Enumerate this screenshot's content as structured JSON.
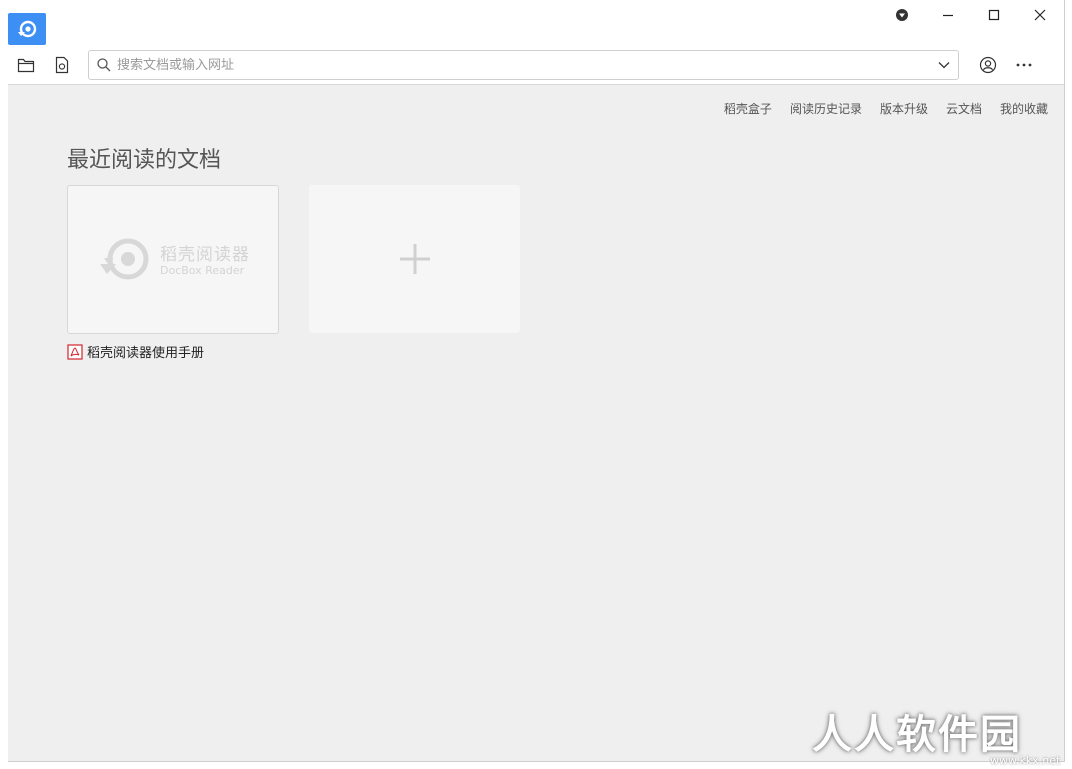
{
  "app": {
    "name": "稻壳阅读器",
    "name_en": "DocBox Reader",
    "accent": "#3d8ff4"
  },
  "titlebar": {
    "icons": [
      "app-logo-icon",
      "user-dropdown-icon",
      "minimize-icon",
      "maximize-icon",
      "close-icon"
    ]
  },
  "toolbar": {
    "search_placeholder": "搜索文档或输入网址",
    "search_value": "",
    "icons": [
      "folder-open-icon",
      "file-icon",
      "search-icon",
      "chevron-down-icon",
      "account-icon",
      "more-icon"
    ]
  },
  "nav": {
    "links": [
      "稻壳盒子",
      "阅读历史记录",
      "版本升级",
      "云文档",
      "我的收藏"
    ]
  },
  "main": {
    "section_title": "最近阅读的文档",
    "recent_docs": [
      {
        "name": "稻壳阅读器使用手册",
        "type": "pdf",
        "thumb_cn": "稻壳阅读器",
        "thumb_en": "DocBox Reader"
      }
    ],
    "add_button": "+"
  },
  "watermark": {
    "text": "人人软件园",
    "url": "www.kkx.net"
  }
}
